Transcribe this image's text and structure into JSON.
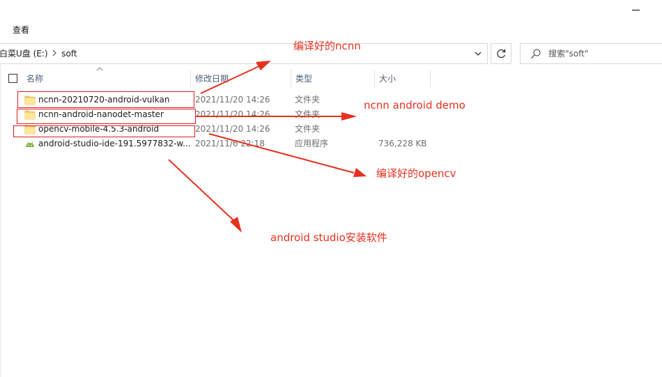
{
  "window": {
    "minimize_icon": "minimize-icon"
  },
  "ribbon": {
    "view_tab": "查看"
  },
  "address_bar": {
    "drive": "白菜U盘 (E:)",
    "separator": ">",
    "folder": "soft",
    "dropdown_icon": "chevron-down-icon",
    "refresh_icon": "refresh-icon"
  },
  "search": {
    "placeholder": "搜索\"soft\"",
    "icon": "search-icon"
  },
  "columns": {
    "name": "名称",
    "date": "修改日期",
    "type": "类型",
    "size": "大小"
  },
  "files": [
    {
      "name": "ncnn-20210720-android-vulkan",
      "date": "2021/11/20 14:26",
      "type": "文件夹",
      "size": "",
      "icon": "folder-icon"
    },
    {
      "name": "ncnn-android-nanodet-master",
      "date": "2021/11/20 14:26",
      "type": "文件夹",
      "size": "",
      "icon": "folder-icon"
    },
    {
      "name": "opencv-mobile-4.5.3-android",
      "date": "2021/11/20 14:26",
      "type": "文件夹",
      "size": "",
      "icon": "folder-icon"
    },
    {
      "name": "android-studio-ide-191.5977832-w...",
      "date": "2021/11/6 22:18",
      "type": "应用程序",
      "size": "736,228 KB",
      "icon": "android-app-icon"
    }
  ],
  "annotations": {
    "ncnn": "编译好的ncnn",
    "demo": "ncnn android demo",
    "opencv": "编译好的opencv",
    "studio": "android studio安装软件",
    "color": "#e8301e"
  }
}
